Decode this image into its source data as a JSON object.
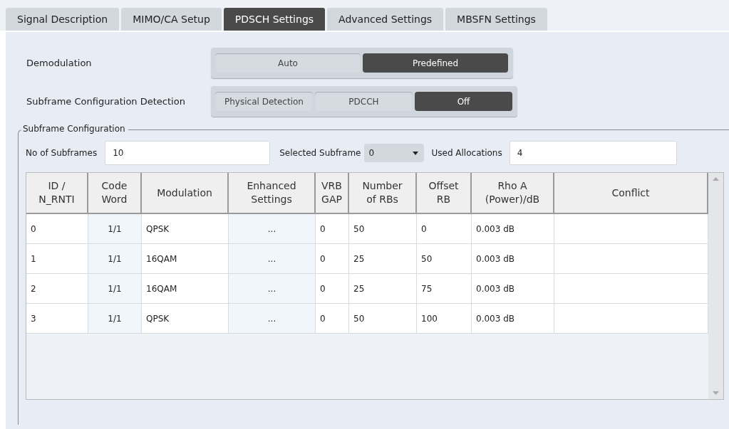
{
  "tabs": [
    {
      "label": "Signal Description",
      "selected": false
    },
    {
      "label": "MIMO/CA Setup",
      "selected": false
    },
    {
      "label": "PDSCH Settings",
      "selected": true
    },
    {
      "label": "Advanced Settings",
      "selected": false
    },
    {
      "label": "MBSFN Settings",
      "selected": false
    }
  ],
  "settings": [
    {
      "label": "Demodulation",
      "options": [
        {
          "label": "Auto",
          "selected": false
        },
        {
          "label": "Predefined",
          "selected": true
        }
      ]
    },
    {
      "label": "Subframe Configuration Detection",
      "options": [
        {
          "label": "Physical Detection",
          "selected": false
        },
        {
          "label": "PDCCH",
          "selected": false
        },
        {
          "label": "Off",
          "selected": true
        }
      ]
    }
  ],
  "subframe_configuration": {
    "title": "Subframe Configuration",
    "no_of_subframes": {
      "label": "No of Subframes",
      "value": "10"
    },
    "selected_subframe": {
      "label": "Selected Subframe",
      "value": "0"
    },
    "used_allocations": {
      "label": "Used Allocations",
      "value": "4"
    },
    "table": {
      "columns": [
        {
          "label": "ID /\nN_RNTI",
          "kind": "plain"
        },
        {
          "label": "Code\nWord",
          "kind": "shaded"
        },
        {
          "label": "Modulation",
          "kind": "plain"
        },
        {
          "label": "Enhanced\nSettings",
          "kind": "shaded"
        },
        {
          "label": "VRB\nGAP",
          "kind": "plain"
        },
        {
          "label": "Number\nof RBs",
          "kind": "plain"
        },
        {
          "label": "Offset\nRB",
          "kind": "plain"
        },
        {
          "label": "Rho A\n(Power)/dB",
          "kind": "plain"
        },
        {
          "label": "Conflict",
          "kind": "plain"
        }
      ],
      "rows": [
        [
          "0",
          "1/1",
          "QPSK",
          "...",
          "0",
          "50",
          "0",
          "0.003 dB",
          ""
        ],
        [
          "1",
          "1/1",
          "16QAM",
          "...",
          "0",
          "25",
          "50",
          "0.003 dB",
          ""
        ],
        [
          "2",
          "1/1",
          "16QAM",
          "...",
          "0",
          "25",
          "75",
          "0.003 dB",
          ""
        ],
        [
          "3",
          "1/1",
          "QPSK",
          "...",
          "0",
          "50",
          "100",
          "0.003 dB",
          ""
        ]
      ]
    }
  }
}
